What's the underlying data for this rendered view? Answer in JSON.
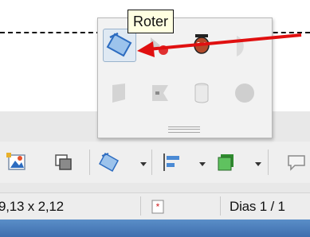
{
  "tooltip": {
    "text": "Roter"
  },
  "status": {
    "size": "9,13 x 2,12",
    "pages": "Dias 1 / 1"
  },
  "colors": {
    "accent_blue": "#3a7bd5",
    "arrow_red": "#e01010",
    "tooltip_bg": "#ffffe1",
    "selection": "#dfe9f3",
    "taskbar": "#4a7cba"
  },
  "popup": {
    "icons": [
      {
        "name": "rotate-icon",
        "selected": true
      },
      {
        "name": "flip-icon",
        "selected": false
      },
      {
        "name": "object-3d-icon",
        "selected": false
      },
      {
        "name": "shadow-icon",
        "selected": false
      },
      {
        "name": "crop-icon",
        "selected": false
      },
      {
        "name": "glue-point-icon",
        "selected": false
      },
      {
        "name": "cylinder-icon",
        "selected": false
      },
      {
        "name": "sphere-icon",
        "selected": false
      }
    ]
  },
  "toolbar": {
    "icons": [
      "insert-image-icon",
      "arrange-icon",
      "rotate-dropdown-icon",
      "align-dropdown-icon",
      "shape-dropdown-icon",
      "comment-icon"
    ]
  }
}
